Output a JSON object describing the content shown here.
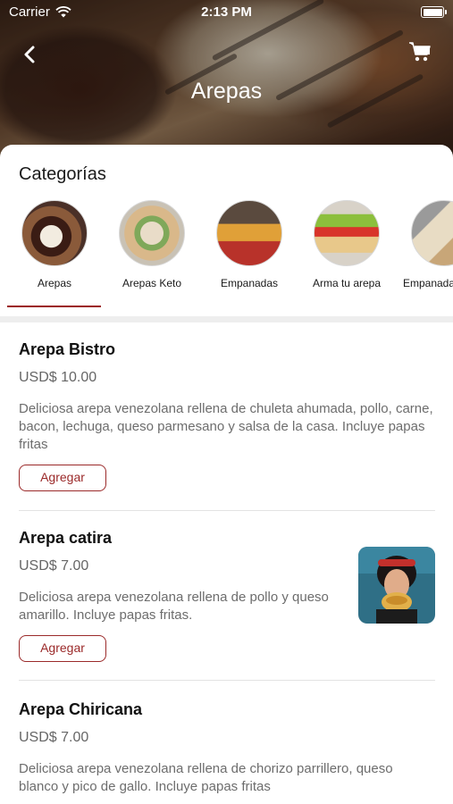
{
  "status_bar": {
    "carrier": "Carrier",
    "time": "2:13 PM"
  },
  "header": {
    "title": "Arepas",
    "back_icon": "chevron-left-icon",
    "cart_icon": "cart-icon"
  },
  "categories": {
    "heading": "Categorías",
    "selected_index": 0,
    "items": [
      {
        "label": "Arepas"
      },
      {
        "label": "Arepas Keto"
      },
      {
        "label": "Empanadas"
      },
      {
        "label": "Arma tu arepa"
      },
      {
        "label": "Empanadas Keto"
      }
    ]
  },
  "menu": {
    "add_label": "Agregar",
    "items": [
      {
        "name": "Arepa Bistro",
        "price": "USD$ 10.00",
        "description": "Deliciosa arepa venezolana rellena de chuleta ahumada, pollo, carne, bacon, lechuga, queso parmesano y salsa de la casa. Incluye papas fritas"
      },
      {
        "name": "Arepa catira",
        "price": "USD$ 7.00",
        "description": "Deliciosa arepa venezolana rellena de pollo y queso amarillo. Incluye papas fritas."
      },
      {
        "name": "Arepa Chiricana",
        "price": "USD$ 7.00",
        "description": "Deliciosa arepa venezolana rellena de chorizo parrillero, queso blanco y pico de gallo. Incluye papas fritas"
      }
    ]
  },
  "colors": {
    "accent": "#9b2a2a",
    "underline": "#9b1b1b"
  }
}
